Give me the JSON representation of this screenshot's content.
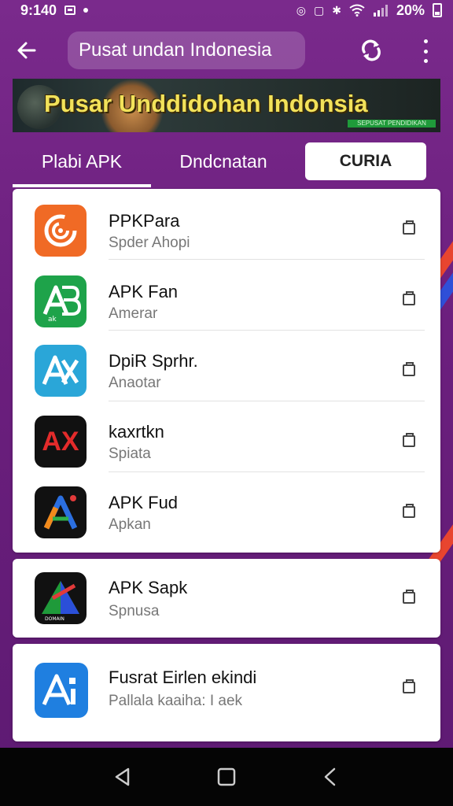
{
  "status_bar": {
    "time": "9:140",
    "battery": "20%"
  },
  "app_bar": {
    "search_text": "Pusat undan Indonesia"
  },
  "banner": {
    "title": "Pusar Unddidohan Indonsia",
    "tag": "SEPUSAT PENDIDIKAN"
  },
  "tabs": [
    {
      "label": "Plabi APK"
    },
    {
      "label": "Dndcnatan"
    },
    {
      "label": "CURIA"
    }
  ],
  "apps": [
    {
      "name": "PPKPara",
      "sub": "Spder Ahopi",
      "icon": "app-icon-orange-swirl",
      "color": "#f06a25"
    },
    {
      "name": "APK Fan",
      "sub": "Amerar",
      "icon": "app-icon-green-ab",
      "color": "#1ea34a"
    },
    {
      "name": "DpiR Sprhr.",
      "sub": "Anaotar",
      "icon": "app-icon-blue-ax",
      "color": "#2aa6d8"
    },
    {
      "name": "kaxrtkn",
      "sub": "Spiata",
      "icon": "app-icon-black-ax",
      "color": "#111111"
    },
    {
      "name": "APK Fud",
      "sub": "Apkan",
      "icon": "app-icon-black-a",
      "color": "#111111"
    },
    {
      "name": "APK Sapk",
      "sub": "Spnusa",
      "icon": "app-icon-black-triangle",
      "color": "#111111"
    },
    {
      "name": "Fusrat Eirlen ekindi",
      "sub": "Pallala kaaiha: I aek",
      "icon": "app-icon-blue-a",
      "color": "#1f7fe0"
    }
  ],
  "icon_texts": {
    "ax_red": "AX",
    "ak_small": "ak",
    "tri_small": "DOMAIN"
  }
}
